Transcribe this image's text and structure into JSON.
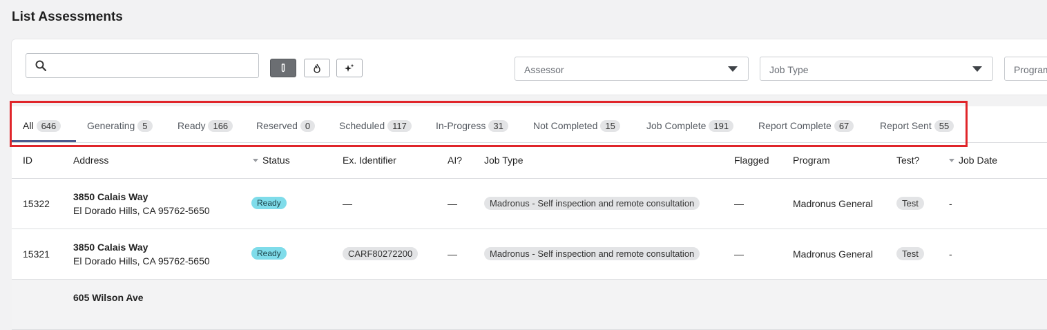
{
  "page": {
    "title": "List Assessments"
  },
  "filters": {
    "search_value": "",
    "assessor_placeholder": "Assessor",
    "job_type_placeholder": "Job Type",
    "program_placeholder": "Program"
  },
  "tabs": [
    {
      "label": "All",
      "count": "646"
    },
    {
      "label": "Generating",
      "count": "5"
    },
    {
      "label": "Ready",
      "count": "166"
    },
    {
      "label": "Reserved",
      "count": "0"
    },
    {
      "label": "Scheduled",
      "count": "117"
    },
    {
      "label": "In-Progress",
      "count": "31"
    },
    {
      "label": "Not Completed",
      "count": "15"
    },
    {
      "label": "Job Complete",
      "count": "191"
    },
    {
      "label": "Report Complete",
      "count": "67"
    },
    {
      "label": "Report Sent",
      "count": "55"
    }
  ],
  "columns": {
    "id": "ID",
    "address": "Address",
    "status": "Status",
    "ex_identifier": "Ex. Identifier",
    "ai": "AI?",
    "job_type": "Job Type",
    "flagged": "Flagged",
    "program": "Program",
    "test": "Test?",
    "job_date": "Job Date"
  },
  "rows": [
    {
      "id": "15322",
      "address1": "3850 Calais Way",
      "address2": "El Dorado Hills, CA 95762-5650",
      "status": "Ready",
      "ex_identifier": "—",
      "ai": "—",
      "job_type": "Madronus - Self inspection and remote consultation",
      "flagged": "—",
      "program": "Madronus General",
      "test": "Test",
      "job_date": "-"
    },
    {
      "id": "15321",
      "address1": "3850 Calais Way",
      "address2": "El Dorado Hills, CA 95762-5650",
      "status": "Ready",
      "ex_identifier": "CARF80272200",
      "ai": "—",
      "job_type": "Madronus - Self inspection and remote consultation",
      "flagged": "—",
      "program": "Madronus General",
      "test": "Test",
      "job_date": "-"
    },
    {
      "address1": "605 Wilson Ave"
    }
  ],
  "colors": {
    "highlight": "#e0252a",
    "status_ready": "#7fdcea",
    "tab_underline": "#4c5a8c"
  }
}
